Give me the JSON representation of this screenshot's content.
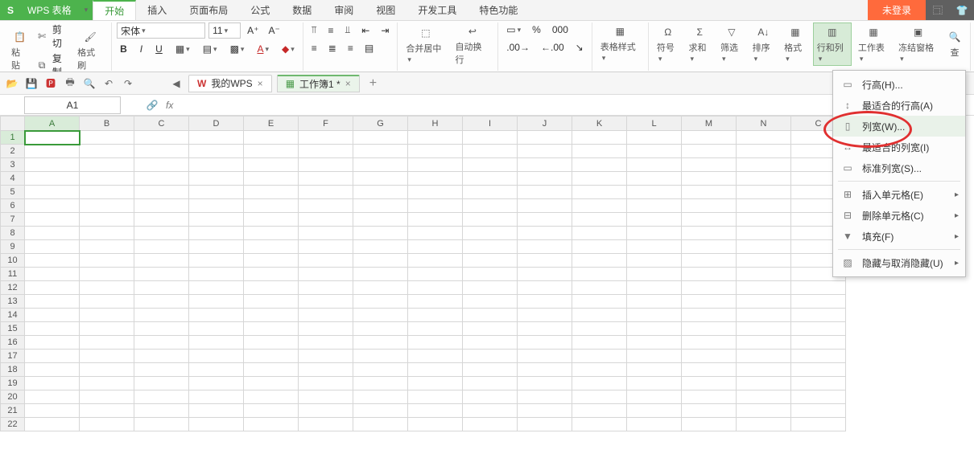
{
  "title": {
    "appName": "WPS 表格"
  },
  "menuTabs": [
    "开始",
    "插入",
    "页面布局",
    "公式",
    "数据",
    "审阅",
    "视图",
    "开发工具",
    "特色功能"
  ],
  "activeTab": 0,
  "signin": "未登录",
  "clipboard": {
    "cut": "剪切",
    "copy": "复制",
    "paste": "粘贴",
    "formatPainter": "格式刷"
  },
  "font": {
    "name": "宋体",
    "size": "11"
  },
  "merge": "合并居中",
  "wrap": "自动换行",
  "percent": "%",
  "tableStyle": "表格样式",
  "symbol": "符号",
  "sum": "求和",
  "filter": "筛选",
  "sort": "排序",
  "format": "格式",
  "rowsCols": "行和列",
  "worksheet": "工作表",
  "freeze": "冻结窗格",
  "find": "查",
  "docTabs": {
    "wps": "我的WPS",
    "book": "工作簿1 *"
  },
  "nameBox": "A1",
  "fx": "fx",
  "columns": [
    "A",
    "B",
    "C",
    "D",
    "E",
    "F",
    "G",
    "H",
    "I",
    "J",
    "K",
    "L",
    "M",
    "N",
    "C"
  ],
  "rows": [
    1,
    2,
    3,
    4,
    5,
    6,
    7,
    8,
    9,
    10,
    11,
    12,
    13,
    14,
    15,
    16,
    17,
    18,
    19,
    20,
    21,
    22
  ],
  "dropdown": {
    "rowHeight": "行高(H)...",
    "bestRowHeight": "最适合的行高(A)",
    "colWidth": "列宽(W)...",
    "bestColWidth": "最适合的列宽(I)",
    "stdWidth": "标准列宽(S)...",
    "insertCells": "插入单元格(E)",
    "deleteCells": "删除单元格(C)",
    "fill": "填充(F)",
    "hide": "隐藏与取消隐藏(U)"
  }
}
